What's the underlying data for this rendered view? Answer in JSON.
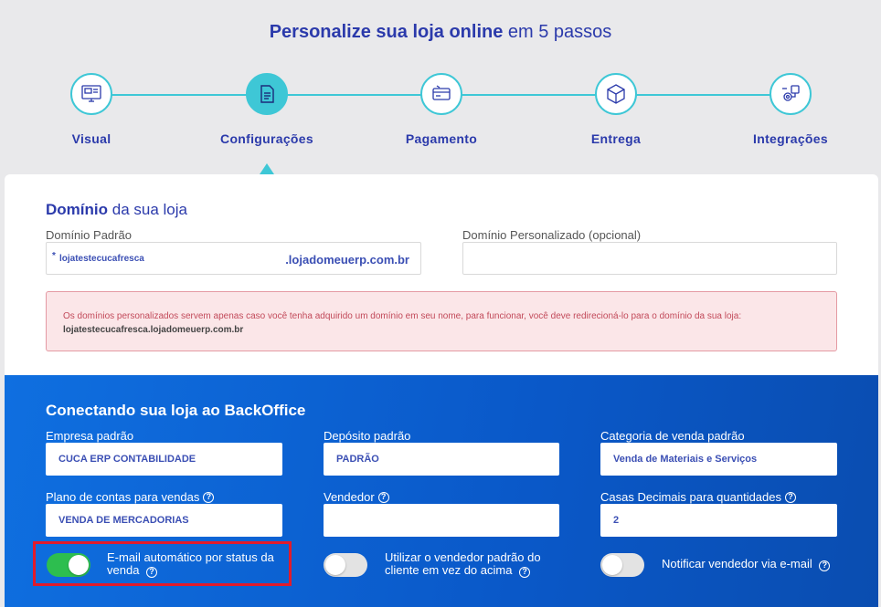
{
  "header": {
    "title_bold": "Personalize sua loja online",
    "title_rest": "em 5 passos"
  },
  "steps": [
    {
      "label": "Visual",
      "icon": "layout-icon"
    },
    {
      "label": "Configurações",
      "icon": "document-icon"
    },
    {
      "label": "Pagamento",
      "icon": "credit-card-icon"
    },
    {
      "label": "Entrega",
      "icon": "box-icon"
    },
    {
      "label": "Integrações",
      "icon": "integration-icon"
    }
  ],
  "domain": {
    "title_bold": "Domínio",
    "title_rest": "da sua loja",
    "default_label": "Domínio Padrão",
    "default_value": "lojatestecucafresca",
    "required_mark": "*",
    "default_suffix": ".lojadomeuerp.com.br",
    "custom_label": "Domínio Personalizado (opcional)",
    "custom_value": "",
    "alert_text": "Os domínios personalizados servem apenas caso você tenha adquirido um domínio em seu nome, para funcionar, você deve redirecioná-lo para o domínio da sua loja:",
    "alert_domain": "lojatestecucafresca.lojadomeuerp.com.br"
  },
  "backoffice": {
    "title": "Conectando sua loja ao BackOffice",
    "empresa_label": "Empresa padrão",
    "empresa_value": "CUCA ERP CONTABILIDADE",
    "deposito_label": "Depósito padrão",
    "deposito_value": "PADRÃO",
    "categoria_label": "Categoria de venda padrão",
    "categoria_value": "Venda de Materiais e Serviços",
    "plano_label": "Plano de contas para vendas",
    "plano_value": "VENDA DE MERCADORIAS",
    "vendedor_label": "Vendedor",
    "vendedor_value": "",
    "casas_label": "Casas Decimais para quantidades",
    "casas_value": "2",
    "help_glyph": "?",
    "toggle_email_label": "E-mail automático por status da venda",
    "toggle_email_on": true,
    "toggle_vendedor_label": "Utilizar o vendedor padrão do cliente em vez do acima",
    "toggle_vendedor_on": false,
    "toggle_notificar_label": "Notificar vendedor via e-mail",
    "toggle_notificar_on": false
  },
  "colors": {
    "accent": "#3ec7d6",
    "brand": "#2b3aab",
    "toggle_on": "#2dbe4f",
    "highlight": "#e21b2b"
  }
}
